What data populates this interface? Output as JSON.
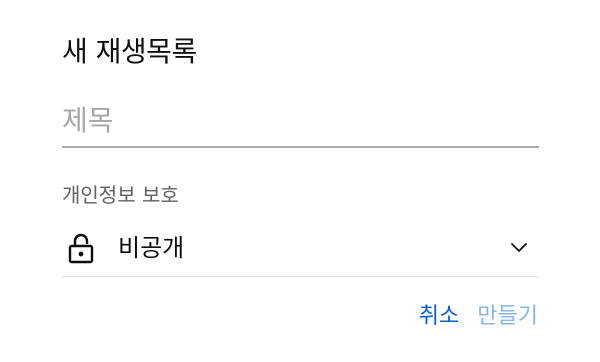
{
  "dialog": {
    "title": "새 재생목록",
    "title_field": {
      "placeholder": "제목",
      "value": ""
    },
    "privacy": {
      "label": "개인정보 보호",
      "selected": "비공개",
      "icon": "lock-icon"
    },
    "actions": {
      "cancel_label": "취소",
      "create_label": "만들기"
    }
  },
  "colors": {
    "accent": "#065fd4",
    "disabled_accent": "#8ab4e8"
  }
}
